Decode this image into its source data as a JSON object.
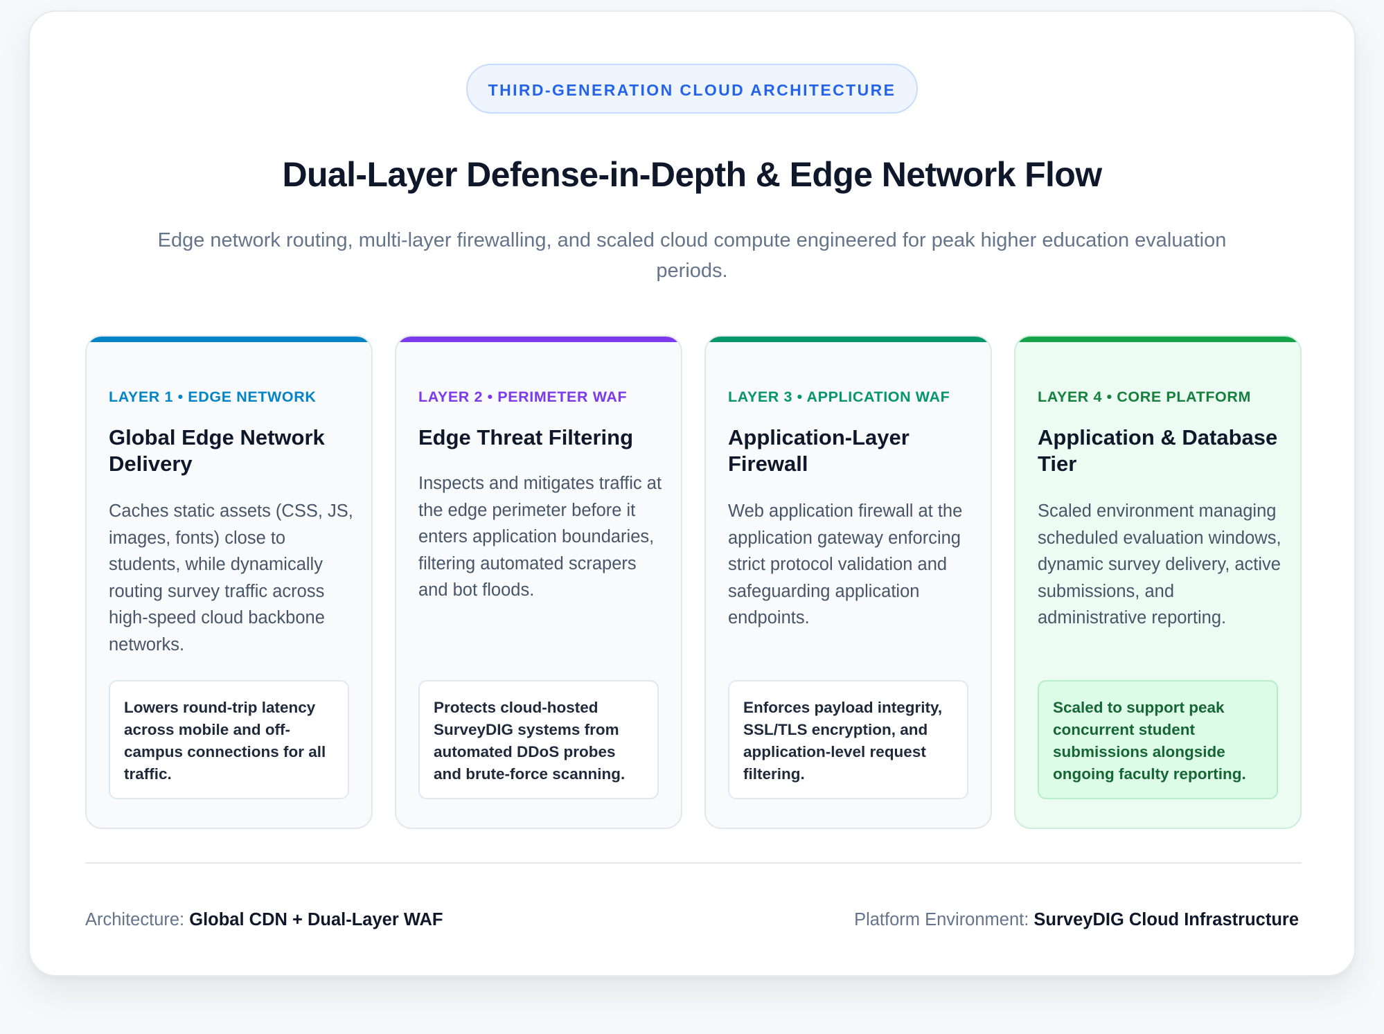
{
  "badge": "THIRD-GENERATION CLOUD ARCHITECTURE",
  "title": "Dual-Layer Defense-in-Depth & Edge Network Flow",
  "subtitle": "Edge network routing, multi-layer firewalling, and scaled cloud compute engineered for peak higher education evaluation periods.",
  "colors": {
    "accent": "#2563eb",
    "layer1": "#0284c7",
    "layer2": "#7c3aed",
    "layer3": "#059669",
    "layer4": "#16a34a"
  },
  "layers": [
    {
      "tag": "LAYER 1 • EDGE NETWORK",
      "heading": "Global Edge Network Delivery",
      "description": "Caches static assets (CSS, JS, images, fonts) close to students, while dynamically routing survey traffic across high-speed cloud backbone networks.",
      "note": "Lowers round-trip latency across mobile and off-campus connections for all traffic."
    },
    {
      "tag": "LAYER 2 • PERIMETER WAF",
      "heading": "Edge Threat Filtering",
      "description": "Inspects and mitigates traffic at the edge perimeter before it enters application boundaries, filtering automated scrapers and bot floods.",
      "note": "Protects cloud-hosted SurveyDIG systems from automated DDoS probes and brute-force scanning."
    },
    {
      "tag": "LAYER 3 • APPLICATION WAF",
      "heading": "Application-Layer Firewall",
      "description": "Web application firewall at the application gateway enforcing strict protocol validation and safeguarding application endpoints.",
      "note": "Enforces payload integrity, SSL/TLS encryption, and application-level request filtering."
    },
    {
      "tag": "LAYER 4 • CORE PLATFORM",
      "heading": "Application & Database Tier",
      "description": "Scaled environment managing scheduled evaluation windows, dynamic survey delivery, active submissions, and administrative reporting.",
      "note": "Scaled to support peak concurrent student submissions alongside ongoing faculty reporting."
    }
  ],
  "footer": {
    "architecture_label": "Architecture:",
    "architecture_value": "Global CDN + Dual-Layer WAF",
    "environment_label": "Platform Environment:",
    "environment_value": "SurveyDIG Cloud Infrastructure"
  }
}
